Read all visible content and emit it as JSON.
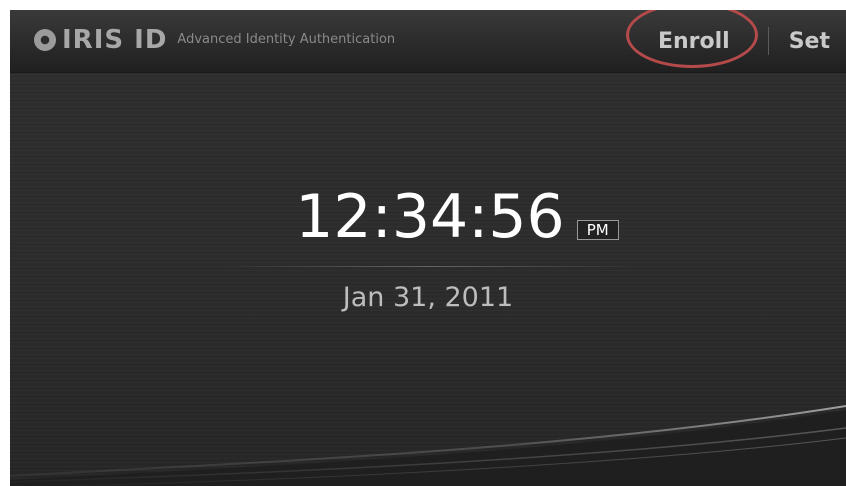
{
  "header": {
    "brand": "IRIS ID",
    "tagline": "Advanced Identity Authentication",
    "nav": {
      "enroll_label": "Enroll",
      "set_label": "Set"
    }
  },
  "clock": {
    "time": "12:34:56",
    "ampm": "PM",
    "date": "Jan 31, 2011"
  },
  "colors": {
    "highlight_ring": "#b54a4a"
  }
}
